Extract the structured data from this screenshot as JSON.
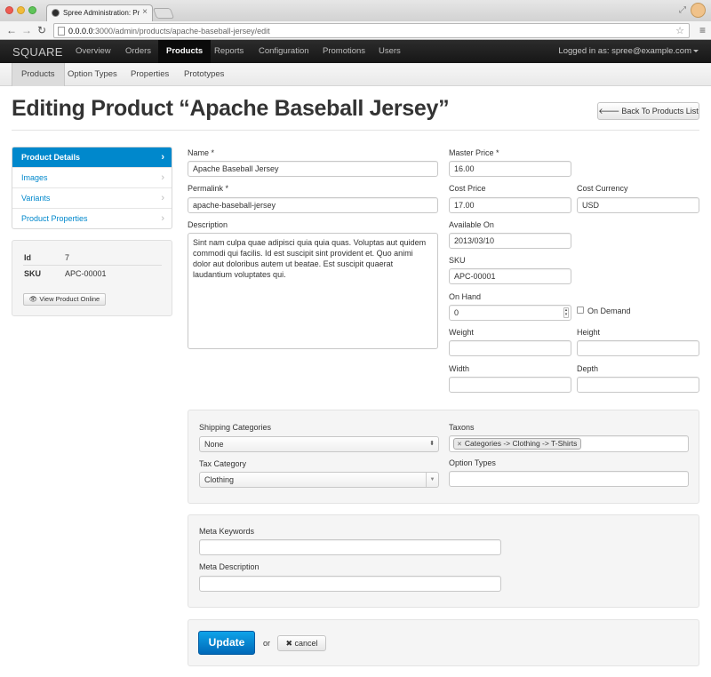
{
  "browser": {
    "tab_title": "Spree Administration: Products",
    "url_host": "0.0.0.0",
    "url_path": ":3000/admin/products/apache-baseball-jersey/edit"
  },
  "topnav": {
    "brand": "SQUARE",
    "items": [
      "Overview",
      "Orders",
      "Products",
      "Reports",
      "Configuration",
      "Promotions",
      "Users"
    ],
    "logged_in": "Logged in as: spree@example.com"
  },
  "subnav": {
    "items": [
      "Products",
      "Option Types",
      "Properties",
      "Prototypes"
    ]
  },
  "page": {
    "title": "Editing Product “Apache Baseball Jersey”",
    "back_button": "Back To Products List"
  },
  "sidebar": {
    "items": [
      "Product Details",
      "Images",
      "Variants",
      "Product Properties"
    ],
    "info": {
      "id_label": "Id",
      "id_value": "7",
      "sku_label": "SKU",
      "sku_value": "APC-00001",
      "view_online": "View Product Online"
    }
  },
  "form": {
    "name_label": "Name *",
    "name_value": "Apache Baseball Jersey",
    "permalink_label": "Permalink *",
    "permalink_value": "apache-baseball-jersey",
    "description_label": "Description",
    "description_value": "Sint nam culpa quae adipisci quia quia quas. Voluptas aut quidem commodi qui facilis. Id est suscipit sint provident et. Quo animi dolor aut doloribus autem ut beatae. Est suscipit quaerat laudantium voluptates qui.",
    "master_price_label": "Master Price *",
    "master_price_value": "16.00",
    "cost_price_label": "Cost Price",
    "cost_price_value": "17.00",
    "cost_currency_label": "Cost Currency",
    "cost_currency_value": "USD",
    "available_on_label": "Available On",
    "available_on_value": "2013/03/10",
    "sku_label": "SKU",
    "sku_value": "APC-00001",
    "on_hand_label": "On Hand",
    "on_hand_value": "0",
    "on_demand_label": "On Demand",
    "weight_label": "Weight",
    "weight_value": "",
    "height_label": "Height",
    "height_value": "",
    "width_label": "Width",
    "width_value": "",
    "depth_label": "Depth",
    "depth_value": ""
  },
  "categories": {
    "shipping_label": "Shipping Categories",
    "shipping_value": "None",
    "taxons_label": "Taxons",
    "taxon_token": "Categories -> Clothing -> T-Shirts",
    "tax_label": "Tax Category",
    "tax_value": "Clothing",
    "option_types_label": "Option Types",
    "option_types_value": ""
  },
  "meta": {
    "keywords_label": "Meta Keywords",
    "keywords_value": "",
    "description_label": "Meta Description",
    "description_value": ""
  },
  "actions": {
    "update": "Update",
    "or": "or",
    "cancel": "cancel"
  },
  "colors": {
    "accent": "#0088cc",
    "topnav_bg": "#1d1d1d"
  }
}
